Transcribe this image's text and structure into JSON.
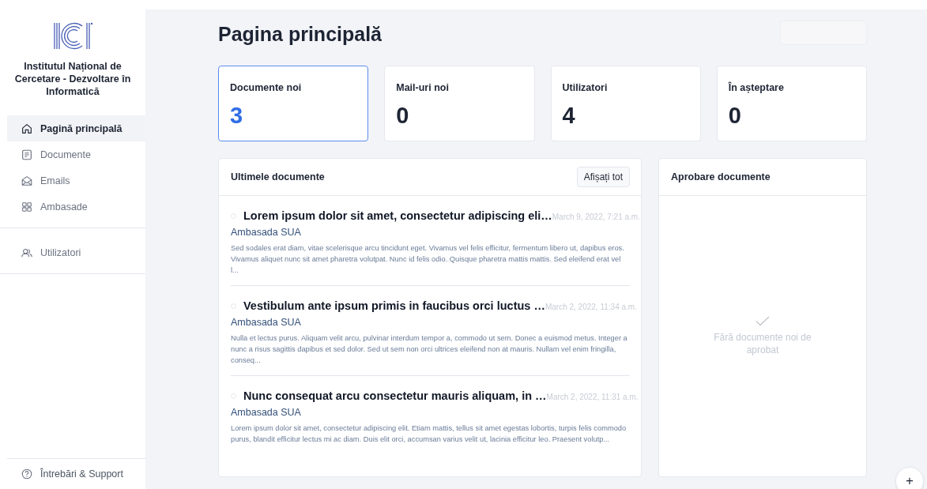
{
  "sidebar": {
    "org_name": "Institutul Național de Cercetare - Dezvoltare în Informatică",
    "sections": [
      {
        "items": [
          {
            "label": "Pagină principală",
            "kind": "home",
            "selected": true
          },
          {
            "label": "Documente",
            "kind": "document",
            "selected": false
          },
          {
            "label": "Emails",
            "kind": "mail",
            "selected": false
          },
          {
            "label": "Ambasade",
            "kind": "grid",
            "selected": false
          }
        ]
      },
      {
        "items": [
          {
            "label": "Utilizatori",
            "kind": "users",
            "selected": false
          }
        ]
      }
    ],
    "footer": {
      "label": "Întrebări & Support",
      "kind": "help"
    }
  },
  "page_title": "Pagina principală",
  "stats": [
    {
      "label": "Documente noi",
      "value": "3",
      "selected": true
    },
    {
      "label": "Mail-uri noi",
      "value": "0",
      "selected": false
    },
    {
      "label": "Utilizatori",
      "value": "4",
      "selected": false
    },
    {
      "label": "În așteptare",
      "value": "0",
      "selected": false
    }
  ],
  "latest_documents": {
    "title": "Ultimele documente",
    "button": "Afișați tot",
    "items": [
      {
        "title": "Lorem ipsum dolor sit amet, consectetur adipiscing eli…",
        "date": "March 9, 2022, 7:21 a.m.",
        "source": "Ambasada SUA",
        "excerpt": "Sed sodales erat diam, vitae scelerisque arcu tincidunt eget. Vivamus vel felis efficitur, fermentum libero ut, dapibus eros. Vivamus aliquet nunc sit amet pharetra volutpat. Nunc id felis odio. Quisque pharetra mattis mattis. Sed eleifend erat vel l..."
      },
      {
        "title": "Vestibulum ante ipsum primis in faucibus orci luctus …",
        "date": "March 2, 2022, 11:34 a.m.",
        "source": "Ambasada SUA",
        "excerpt": "Nulla et lectus purus. Aliquam velit arcu, pulvinar interdum tempor a, commodo ut sem. Donec a euismod metus. Integer a nunc a risus sagittis dapibus et sed dolor. Sed ut sem non orci ultrices eleifend non at mauris. Nullam vel enim fringilla, conseq..."
      },
      {
        "title": "Nunc consequat arcu consectetur mauris aliquam, in …",
        "date": "March 2, 2022, 11:31 a.m.",
        "source": "Ambasada SUA",
        "excerpt": "Lorem ipsum dolor sit amet, consectetur adipiscing elit. Etiam mattis, tellus sit amet egestas lobortis, turpis felis commodo purus, blandit efficitur lectus mi ac diam. Duis elit orci, accumsan varius velit ut, lacinia efficitur leo. Praesent volutp..."
      }
    ]
  },
  "approval": {
    "title": "Aprobare documente",
    "empty_message": "Fără documente noi de aprobat"
  },
  "fab": "+"
}
